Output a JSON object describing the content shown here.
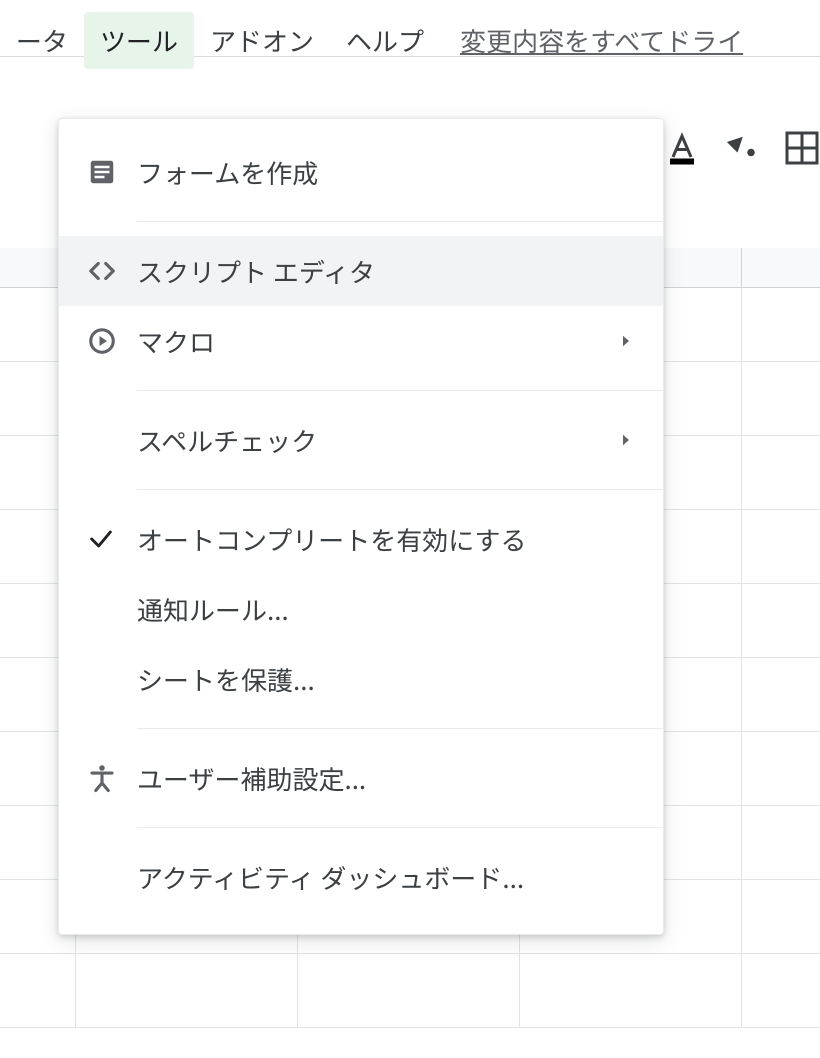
{
  "menubar": {
    "items": [
      {
        "label": "ータ"
      },
      {
        "label": "ツール"
      },
      {
        "label": "アドオン"
      },
      {
        "label": "ヘルプ"
      }
    ],
    "active_index": 1,
    "status_link": "変更内容をすべてドライ"
  },
  "dropdown": {
    "items": [
      {
        "icon": "form",
        "label": "フォームを作成",
        "has_submenu": false
      },
      {
        "separator": true
      },
      {
        "icon": "code",
        "label": "スクリプト エディタ",
        "has_submenu": false,
        "hover": true
      },
      {
        "icon": "play",
        "label": "マクロ",
        "has_submenu": true
      },
      {
        "separator": true
      },
      {
        "icon": "",
        "label": "スペルチェック",
        "has_submenu": true
      },
      {
        "separator": true
      },
      {
        "icon": "check",
        "label": "オートコンプリートを有効にする",
        "has_submenu": false
      },
      {
        "icon": "",
        "label": "通知ルール...",
        "has_submenu": false
      },
      {
        "icon": "",
        "label": "シートを保護...",
        "has_submenu": false
      },
      {
        "separator": true
      },
      {
        "icon": "accessibility",
        "label": "ユーザー補助設定...",
        "has_submenu": false
      },
      {
        "separator": true
      },
      {
        "icon": "",
        "label": "アクティビティ ダッシュボード...",
        "has_submenu": false
      }
    ]
  }
}
